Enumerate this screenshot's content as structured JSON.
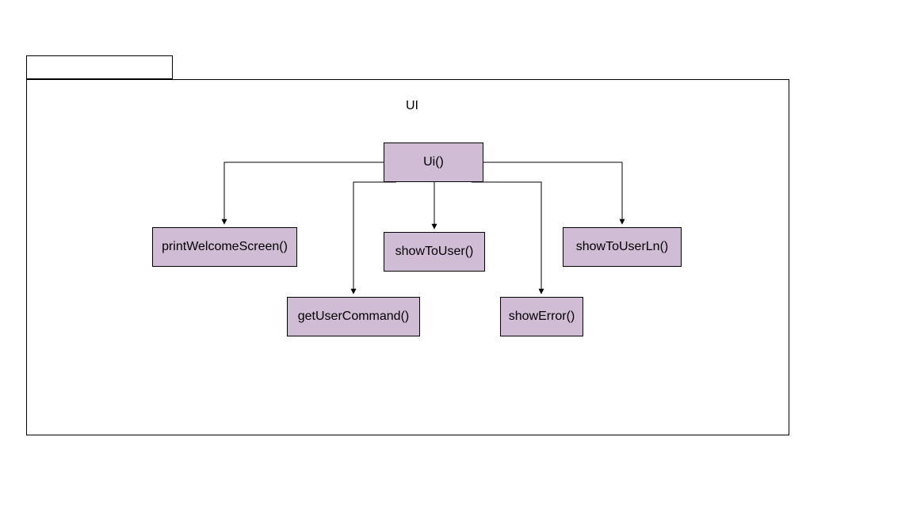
{
  "package": {
    "title": "UI"
  },
  "nodes": {
    "root": "Ui()",
    "printWelcomeScreen": "printWelcomeScreen()",
    "showToUser": "showToUser()",
    "showToUserLn": "showToUserLn()",
    "getUserCommand": "getUserCommand()",
    "showError": "showError()"
  },
  "colors": {
    "nodeFill": "#D0BDD5",
    "stroke": "#000000"
  }
}
